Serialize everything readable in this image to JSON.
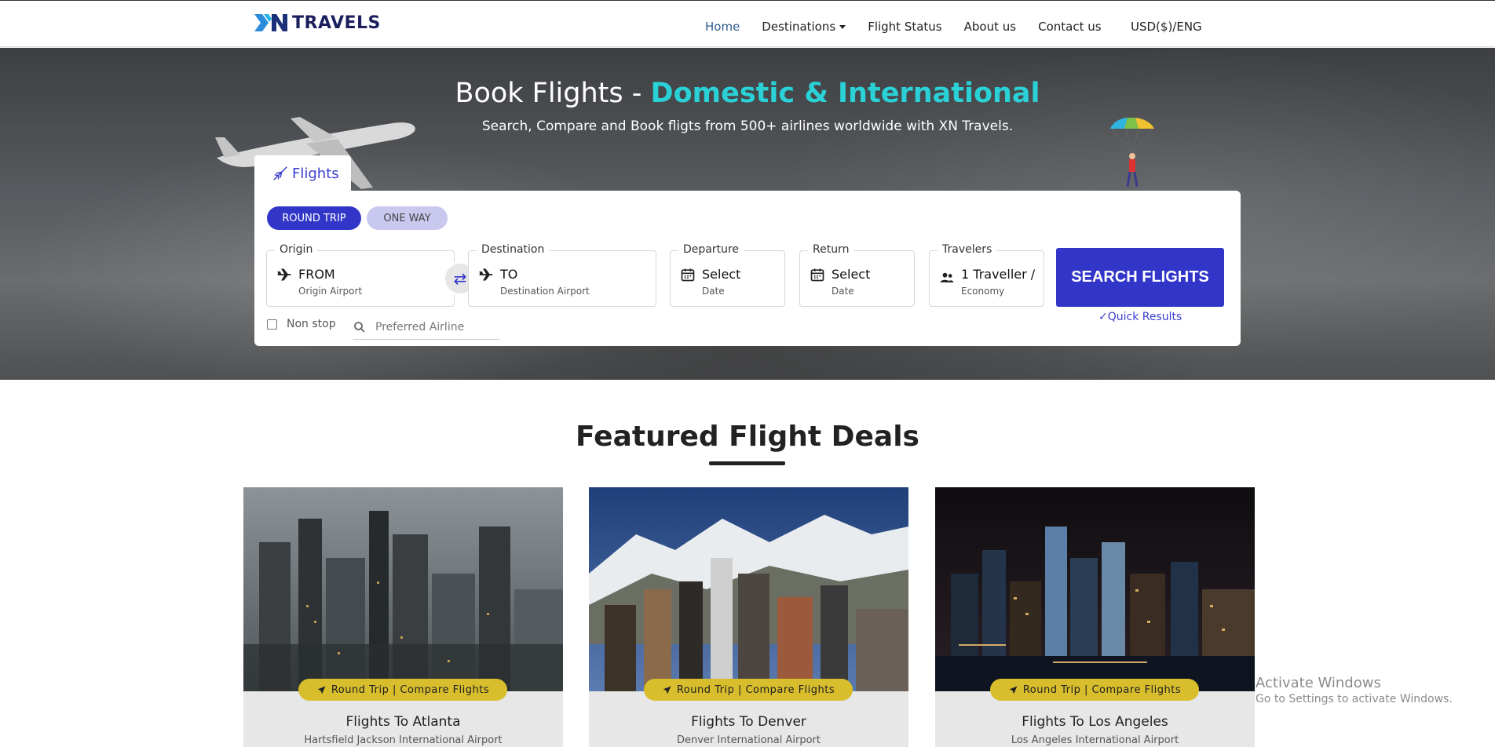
{
  "header": {
    "brand": "TRAVELS",
    "nav": [
      "Home",
      "Destinations",
      "Flight Status",
      "About us",
      "Contact us"
    ],
    "currency": "USD($)/ENG"
  },
  "hero": {
    "title_plain": "Book Flights - ",
    "title_accent": "Domestic & International",
    "subtitle": "Search, Compare and Book fligts from 500+ airlines worldwide with XN Travels."
  },
  "search": {
    "tab_label": "Flights",
    "trip_types": [
      "ROUND TRIP",
      "ONE WAY"
    ],
    "selected_trip": "ROUND TRIP",
    "origin": {
      "label": "Origin",
      "value": "FROM",
      "sub": "Origin Airport"
    },
    "destination": {
      "label": "Destination",
      "value": "TO",
      "sub": "Destination Airport"
    },
    "departure": {
      "label": "Departure",
      "value": "Select",
      "sub": "Date"
    },
    "return": {
      "label": "Return",
      "value": "Select",
      "sub": "Date"
    },
    "travelers": {
      "label": "Travelers",
      "value": "1 Traveller /",
      "sub": "Economy"
    },
    "search_button": "SEARCH FLIGHTS",
    "quick_results": "Quick Results",
    "nonstop_label": "Non stop",
    "airline_placeholder": "Preferred Airline"
  },
  "featured": {
    "title": "Featured Flight Deals",
    "deals": [
      {
        "badge": "Round Trip | Compare Flights",
        "title": "Flights To Atlanta",
        "airport": "Hartsfield Jackson International Airport"
      },
      {
        "badge": "Round Trip | Compare Flights",
        "title": "Flights To Denver",
        "airport": "Denver International Airport"
      },
      {
        "badge": "Round Trip | Compare Flights",
        "title": "Flights To Los Angeles",
        "airport": "Los Angeles International Airport"
      }
    ]
  },
  "watermark": {
    "line1": "Activate Windows",
    "line2": "Go to Settings to activate Windows."
  },
  "colors": {
    "accent_blue": "#3236c8",
    "accent_cyan": "#2ad1d6",
    "badge_yellow": "#d8bd2d"
  }
}
